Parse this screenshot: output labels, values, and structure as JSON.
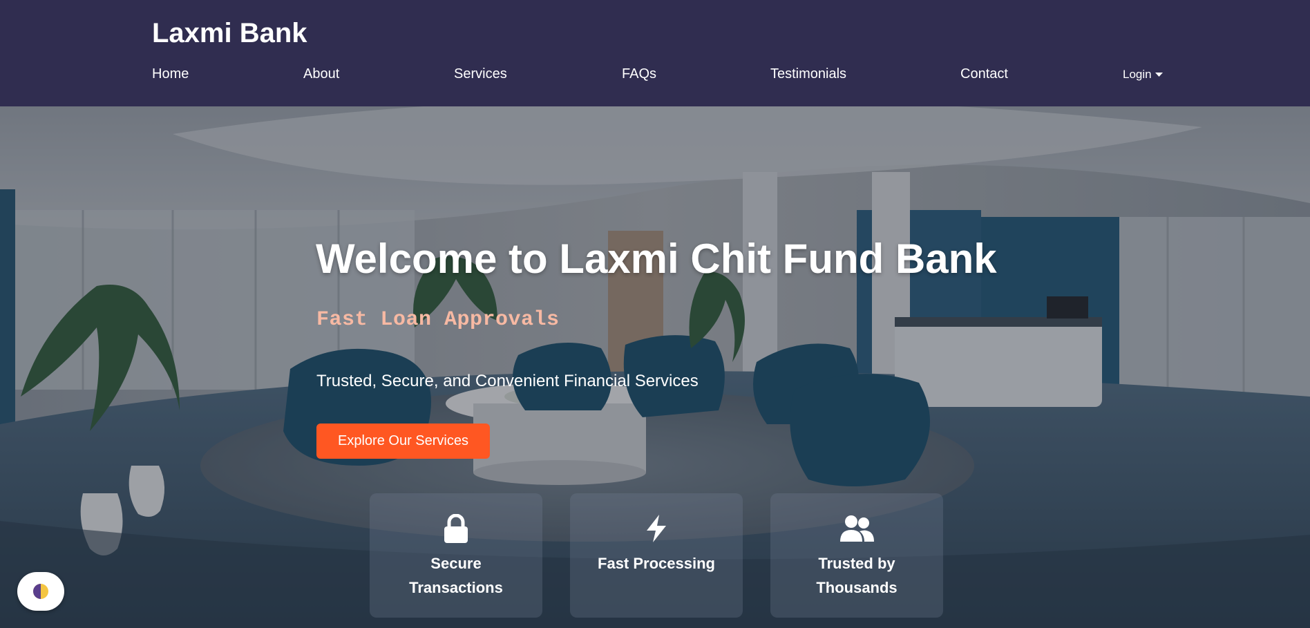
{
  "navbar": {
    "brand": "Laxmi Bank",
    "links": [
      {
        "label": "Home"
      },
      {
        "label": "About"
      },
      {
        "label": "Services"
      },
      {
        "label": "FAQs"
      },
      {
        "label": "Testimonials"
      },
      {
        "label": "Contact"
      }
    ],
    "login": {
      "label": "Login",
      "icon": "caret-down-icon"
    }
  },
  "hero": {
    "title": "Welcome to Laxmi Chit Fund Bank",
    "tagline": "Fast Loan Approvals",
    "subtitle": "Trusted, Secure, and Convenient Financial Services",
    "cta_label": "Explore Our Services",
    "features": [
      {
        "label": "Secure Transactions",
        "icon": "lock-icon"
      },
      {
        "label": "Fast Processing",
        "icon": "bolt-icon"
      },
      {
        "label": "Trusted by Thousands",
        "icon": "users-icon"
      }
    ]
  },
  "theme_toggle": {
    "icon": "half-moon-icon"
  },
  "colors": {
    "navbar": "#302d50",
    "accent": "#ff5722",
    "tagline": "#f7b9a3"
  }
}
